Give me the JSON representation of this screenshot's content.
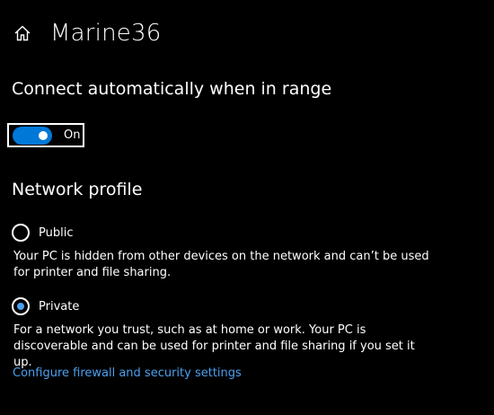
{
  "header": {
    "home_icon": "home-icon",
    "title": "Marine36"
  },
  "auto_connect": {
    "heading": "Connect automatically when in range",
    "toggle_state_label": "On",
    "toggle_on": true,
    "accent_color": "#0078d7"
  },
  "network_profile": {
    "heading": "Network profile",
    "options": [
      {
        "label": "Public",
        "selected": false,
        "description": "Your PC is hidden from other devices on the network and can’t be used for printer and file sharing."
      },
      {
        "label": "Private",
        "selected": true,
        "description": "For a network you trust, such as at home or work. Your PC is discoverable and can be used for printer and file sharing if you set it up."
      }
    ]
  },
  "links": {
    "firewall": "Configure firewall and security settings",
    "link_color": "#4aa0f0"
  }
}
